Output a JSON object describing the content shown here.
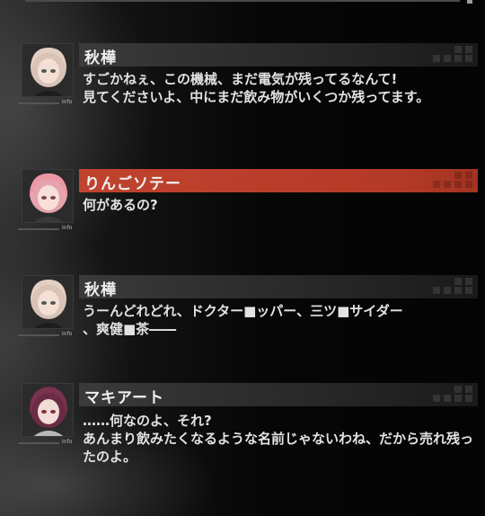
{
  "dialogue": [
    {
      "speaker": "秋樺",
      "text": "すごかねぇ、この機械、まだ電気が残ってるなんて!\n見てくださいよ、中にまだ飲み物がいくつか残ってます。",
      "info": "Info",
      "active": false
    },
    {
      "speaker": "りんごソテー",
      "text": "何があるの?",
      "info": "Info",
      "active": true
    },
    {
      "speaker": "秋樺",
      "text": "うーんどれどれ、ドクター■ッパー、三ツ■サイダー\n、爽健■茶――",
      "info": "Info",
      "active": false
    },
    {
      "speaker": "マキアート",
      "text": "……何なのよ、それ?\nあんまり飲みたくなるような名前じゃないわね、だから売れ残ったのよ。",
      "info": "Info",
      "active": false
    }
  ],
  "colors": {
    "active_name_bar": "#c0432f",
    "name_bar": "#3c3c3c",
    "text": "#e2e2e2"
  }
}
